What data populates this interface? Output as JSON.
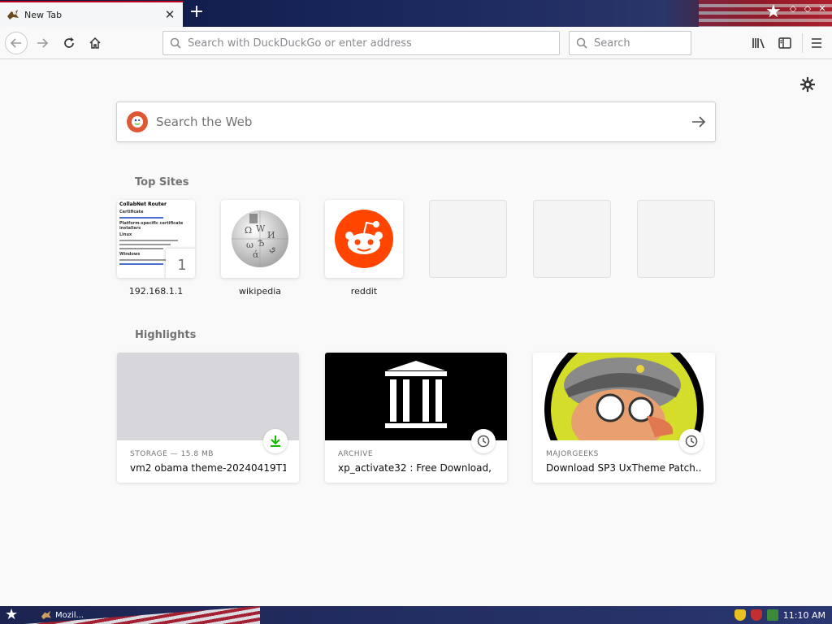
{
  "tab": {
    "title": "New Tab",
    "close_glyph": "✕"
  },
  "new_tab_glyph": "+",
  "window_controls": [
    "minimize-icon",
    "maximize-icon",
    "close-icon"
  ],
  "nav": {
    "url_placeholder": "Search with DuckDuckGo or enter address",
    "search_placeholder": "Search"
  },
  "content": {
    "search_placeholder": "Search the Web",
    "top_sites_title": "Top Sites",
    "highlights_title": "Highlights",
    "top_sites": [
      {
        "label": "192.168.1.1",
        "badge": "1",
        "shot": {
          "title": "CollabNet Router",
          "heading": "Certificate",
          "sub": "Platform-specific certificate installers",
          "h2": "Linux",
          "h3": "Windows"
        }
      },
      {
        "label": "wikipedia"
      },
      {
        "label": "reddit"
      },
      {
        "label": ""
      },
      {
        "label": ""
      },
      {
        "label": ""
      }
    ],
    "highlights": [
      {
        "source": "STORAGE — 15.8 MB",
        "title": "vm2 obama theme-20240419T1...",
        "badge": "download-icon"
      },
      {
        "source": "ARCHIVE",
        "title": "xp_activate32 : Free Download, ...",
        "badge": "clock-icon"
      },
      {
        "source": "MAJORGEEKS",
        "title": "Download SP3 UxTheme Patch...",
        "badge": "clock-icon"
      }
    ]
  },
  "taskbar": {
    "app_label": "Mozil...",
    "time": "11:10 AM"
  },
  "colors": {
    "accent": "#c0001a",
    "ddg": "#de5833",
    "reddit": "#ff4500",
    "download_green": "#12bc00"
  }
}
